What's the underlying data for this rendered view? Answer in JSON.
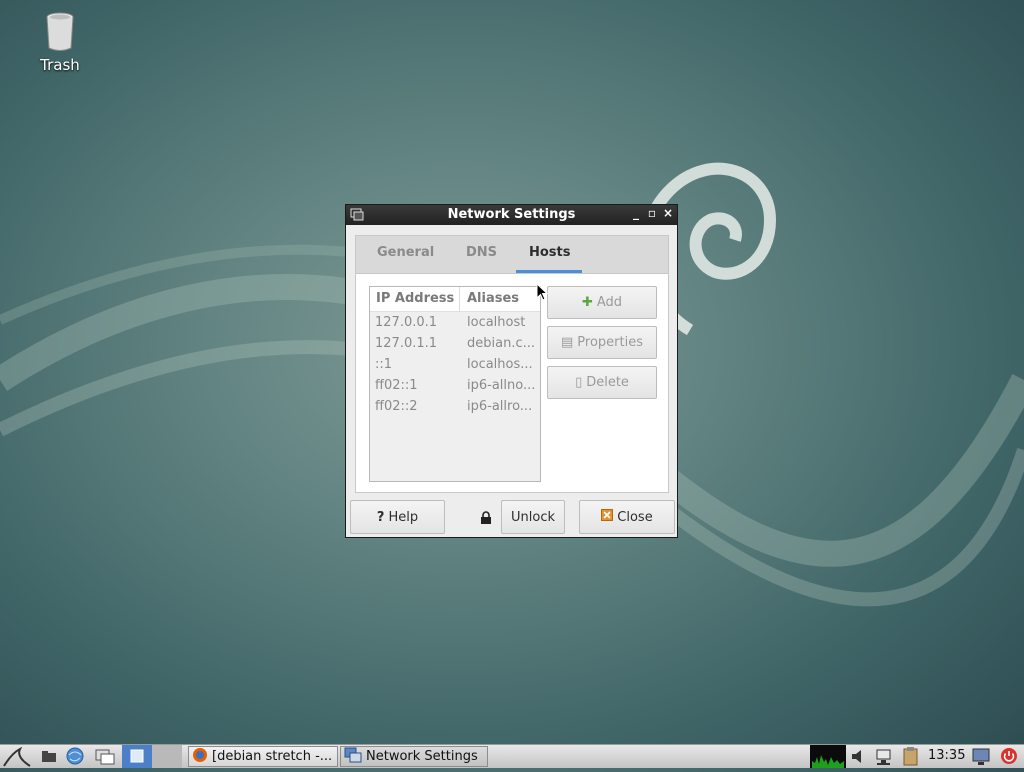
{
  "desktop": {
    "icons": [
      {
        "label": "Trash",
        "icon": "trash-icon"
      }
    ]
  },
  "window": {
    "title": "Network Settings",
    "controls": {
      "minimize": "_",
      "maximize": "▫",
      "close": "×"
    },
    "tabs": [
      {
        "label": "General",
        "active": false
      },
      {
        "label": "DNS",
        "active": false
      },
      {
        "label": "Hosts",
        "active": true
      }
    ],
    "hosts": {
      "columns": [
        "IP Address",
        "Aliases"
      ],
      "rows": [
        {
          "ip": "127.0.0.1",
          "alias": "localhost"
        },
        {
          "ip": "127.0.1.1",
          "alias": "debian.c..."
        },
        {
          "ip": "::1",
          "alias": "localhos..."
        },
        {
          "ip": "ff02::1",
          "alias": "ip6-allno..."
        },
        {
          "ip": "ff02::2",
          "alias": "ip6-allro..."
        }
      ]
    },
    "side_buttons": {
      "add": "Add",
      "properties": "Properties",
      "delete": "Delete"
    },
    "footer": {
      "help": "Help",
      "help_icon": "?",
      "unlock": "Unlock",
      "close": "Close"
    }
  },
  "taskbar": {
    "tasks": [
      {
        "label": "[debian stretch -...",
        "icon": "firefox-icon"
      },
      {
        "label": "Network Settings",
        "icon": "network-icon"
      }
    ],
    "clock": "13:35"
  },
  "colors": {
    "tab_accent": "#4a90d9",
    "add_icon": "#5aa83c",
    "close_icon": "#e8912c",
    "power_icon": "#d9322a"
  }
}
